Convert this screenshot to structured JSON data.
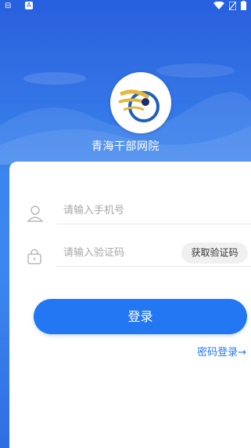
{
  "status_bar": {
    "left_text": "⊟",
    "app_icon_label": "A"
  },
  "app": {
    "title": "青海干部网院"
  },
  "form": {
    "phone_placeholder": "请输入手机号",
    "code_placeholder": "请输入验证码",
    "get_code_label": "获取验证码",
    "login_label": "登录",
    "password_login_label": "密码登录→"
  },
  "colors": {
    "primary": "#2377f2",
    "background": "#2d6fe6",
    "card": "#ffffff"
  }
}
